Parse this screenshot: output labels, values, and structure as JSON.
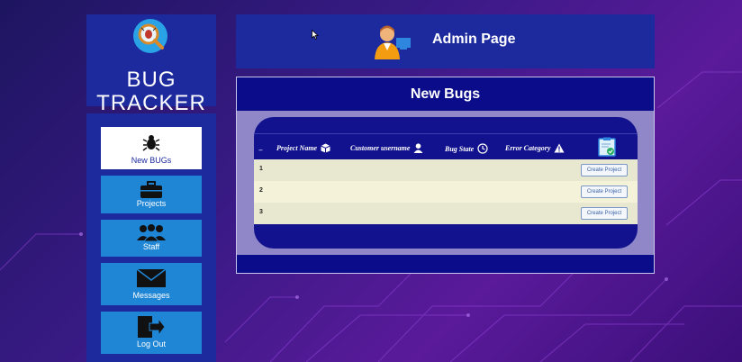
{
  "brand": {
    "line1": "BUG",
    "line2": "TRACKER"
  },
  "header": {
    "title": "Admin Page"
  },
  "sidebar": {
    "items": [
      {
        "label": "New BUGs",
        "icon": "bug-icon",
        "active": true
      },
      {
        "label": "Projects",
        "icon": "briefcase-icon",
        "active": false
      },
      {
        "label": "Staff",
        "icon": "people-icon",
        "active": false
      },
      {
        "label": "Messages",
        "icon": "envelope-icon",
        "active": false
      },
      {
        "label": "Log Out",
        "icon": "logout-icon",
        "active": false
      }
    ]
  },
  "main": {
    "title": "New Bugs",
    "table": {
      "columns": [
        {
          "label": "_"
        },
        {
          "label": "Project Name",
          "icon": "box-icon"
        },
        {
          "label": "Customer username",
          "icon": "user-icon"
        },
        {
          "label": "Bug State",
          "icon": "clock-icon"
        },
        {
          "label": "Error Category",
          "icon": "warning-icon"
        },
        {
          "label": "",
          "icon": "clipboard-check-icon"
        }
      ],
      "rows": [
        {
          "num": "1",
          "action": "Create Project"
        },
        {
          "num": "2",
          "action": "Create Project"
        },
        {
          "num": "3",
          "action": "Create Project"
        }
      ]
    }
  },
  "colors": {
    "sidebar_bg": "#1c2a9e",
    "nav_button": "#1f86d6",
    "panel_header": "#0a0c8a",
    "row_bg": "#e8e7cf"
  }
}
